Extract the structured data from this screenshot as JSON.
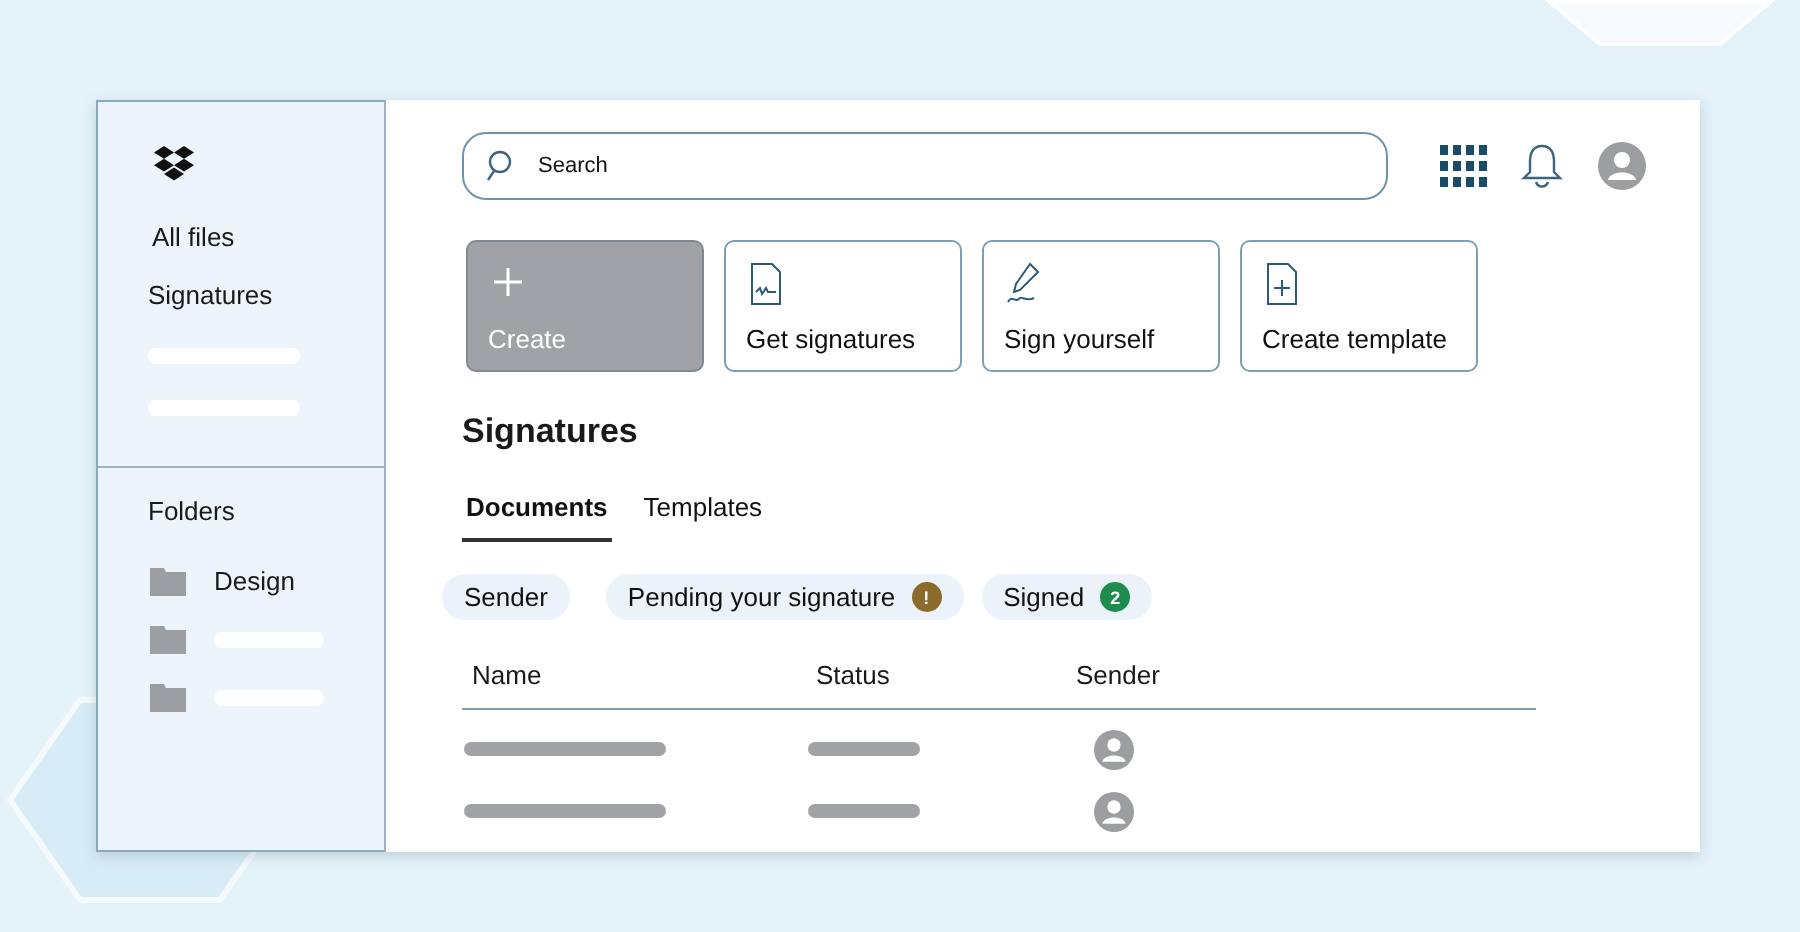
{
  "sidebar": {
    "nav": [
      {
        "label": "All files",
        "kind": "link"
      },
      {
        "label": "Signatures",
        "kind": "link"
      },
      {
        "kind": "skeleton"
      },
      {
        "kind": "skeleton"
      }
    ],
    "folders_title": "Folders",
    "folders": [
      {
        "label": "Design",
        "kind": "folder"
      },
      {
        "kind": "skeleton"
      },
      {
        "kind": "skeleton"
      }
    ]
  },
  "search": {
    "placeholder": "Search"
  },
  "actions": [
    {
      "label": "Create",
      "kind": "create"
    },
    {
      "label": "Get signatures",
      "kind": "document"
    },
    {
      "label": "Sign yourself",
      "kind": "pen"
    },
    {
      "label": "Create template",
      "kind": "template"
    }
  ],
  "heading": "Signatures",
  "tabs": [
    {
      "label": "Documents",
      "selected": true
    },
    {
      "label": "Templates",
      "selected": false
    }
  ],
  "filters": [
    {
      "label": "Sender"
    },
    {
      "label": "Pending your signature",
      "badge": "!",
      "color": "#8c6a2c"
    },
    {
      "label": "Signed",
      "badge": "2",
      "color": "#1e8c4c"
    }
  ],
  "table": {
    "columns": [
      "Name",
      "Status",
      "Sender"
    ],
    "rows": [
      {
        "kind": "skeleton"
      },
      {
        "kind": "skeleton"
      }
    ]
  }
}
